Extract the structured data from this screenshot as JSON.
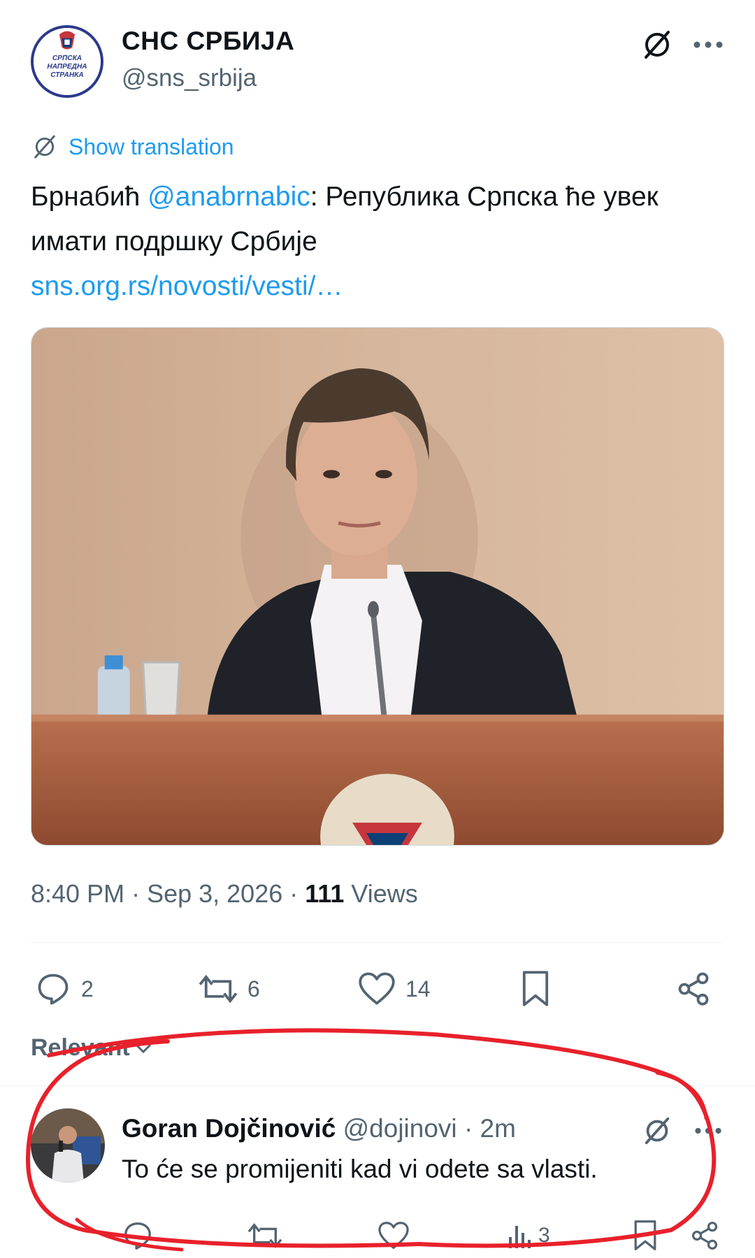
{
  "tweet": {
    "author_name": "СНС СРБИЈА",
    "author_handle": "@sns_srbija",
    "avatar_logo_text": [
      "СРПСКА",
      "НАПРЕДНА",
      "СТРАНКА"
    ],
    "show_translation": "Show translation",
    "text_prefix": "Брнабић ",
    "mention": "@anabrnabic",
    "text_suffix": ": Република Српска ће увек имати подршку Србије",
    "link": "sns.org.rs/novosti/vesti/…",
    "time": "8:40 PM",
    "date": "Sep 3, 2026",
    "views_count": "111",
    "views_label": "Views",
    "replies": "2",
    "reposts": "6",
    "likes": "14"
  },
  "sort": {
    "label": "Relevant"
  },
  "reply": {
    "name": "Goran Dojčinović",
    "handle": "@dojinovi",
    "time": "2m",
    "text": "To će se promijeniti kad vi odete sa vlasti.",
    "views": "3"
  },
  "colors": {
    "accent": "#1d9bf0",
    "secondary_text": "#536471",
    "annotation": "#e8212b"
  },
  "icons": [
    "grok-icon",
    "more-icon",
    "translate-icon",
    "reply-icon",
    "repost-icon",
    "like-icon",
    "bookmark-icon",
    "share-icon",
    "views-icon",
    "chevron-down-icon"
  ]
}
